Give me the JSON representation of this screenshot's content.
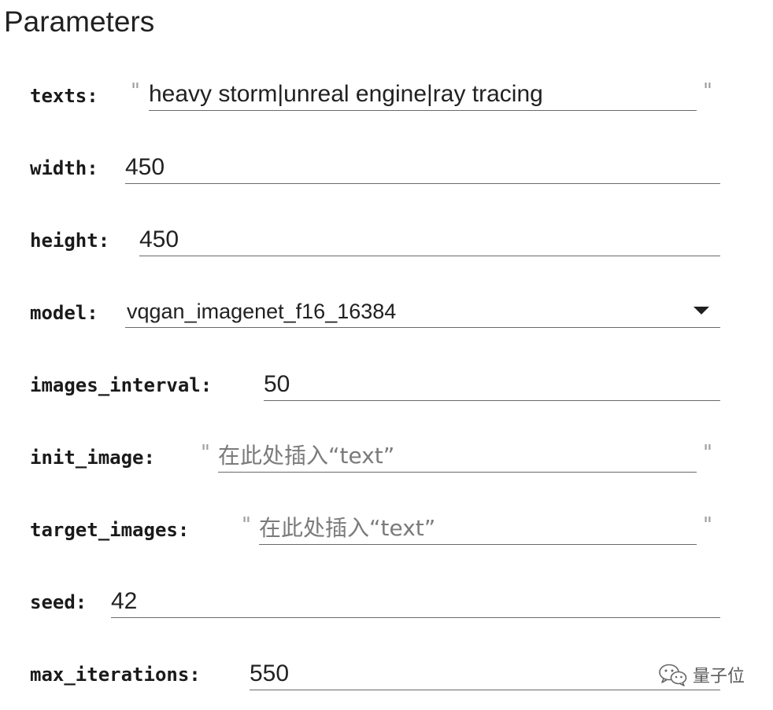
{
  "page": {
    "title": "Parameters"
  },
  "params": {
    "texts": {
      "label": "texts:",
      "value": "heavy storm|unreal engine|ray tracing",
      "open_quote": "\"",
      "close_quote": "\""
    },
    "width": {
      "label": "width:",
      "value": "450"
    },
    "height": {
      "label": "height:",
      "value": "450"
    },
    "model": {
      "label": "model:",
      "value": "vqgan_imagenet_f16_16384"
    },
    "images_interval": {
      "label": "images_interval:",
      "value": "50"
    },
    "init_image": {
      "label": "init_image:",
      "placeholder": "在此处插入“text”",
      "open_quote": "\"",
      "close_quote": "\""
    },
    "target_images": {
      "label": "target_images:",
      "placeholder": "在此处插入“text”",
      "open_quote": "\"",
      "close_quote": "\""
    },
    "seed": {
      "label": "seed:",
      "value": "42"
    },
    "max_iterations": {
      "label": "max_iterations:",
      "value": "550"
    }
  },
  "watermark": {
    "text": "量子位",
    "icon": "wechat-icon"
  }
}
